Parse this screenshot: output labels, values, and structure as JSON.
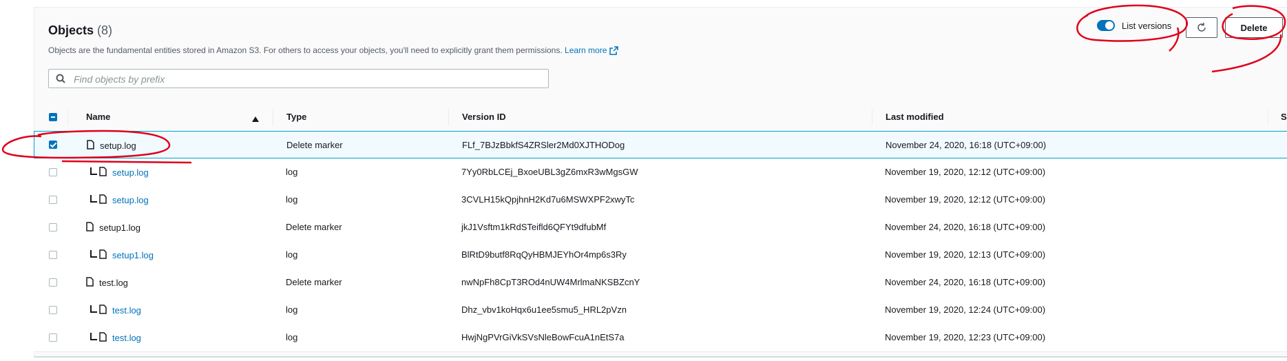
{
  "header": {
    "title": "Objects",
    "count": "(8)",
    "description": "Objects are the fundamental entities stored in Amazon S3. For others to access your objects, you'll need to explicitly grant them permissions.",
    "learn_more": "Learn more"
  },
  "toolbar": {
    "list_versions_label": "List versions",
    "list_versions_on": true,
    "delete_label": "Delete"
  },
  "search": {
    "placeholder": "Find objects by prefix",
    "value": ""
  },
  "table": {
    "columns": [
      "Name",
      "Type",
      "Version ID",
      "Last modified",
      "S"
    ],
    "rows": [
      {
        "name": "setup.log",
        "type": "Delete marker",
        "version_id": "FLf_7BJzBbkfS4ZRSler2Md0XJTHODog",
        "last_modified": "November 24, 2020, 16:18 (UTC+09:00)",
        "checked": true,
        "child": false
      },
      {
        "name": "setup.log",
        "type": "log",
        "version_id": "7Yy0RbLCEj_BxoeUBL3gZ6mxR3wMgsGW",
        "last_modified": "November 19, 2020, 12:12 (UTC+09:00)",
        "checked": false,
        "child": true
      },
      {
        "name": "setup.log",
        "type": "log",
        "version_id": "3CVLH15kQpjhnH2Kd7u6MSWXPF2xwyTc",
        "last_modified": "November 19, 2020, 12:12 (UTC+09:00)",
        "checked": false,
        "child": true
      },
      {
        "name": "setup1.log",
        "type": "Delete marker",
        "version_id": "jkJ1Vsftm1kRdSTeifld6QFYt9dfubMf",
        "last_modified": "November 24, 2020, 16:18 (UTC+09:00)",
        "checked": false,
        "child": false
      },
      {
        "name": "setup1.log",
        "type": "log",
        "version_id": "BlRtD9butf8RqQyHBMJEYhOr4mp6s3Ry",
        "last_modified": "November 19, 2020, 12:13 (UTC+09:00)",
        "checked": false,
        "child": true
      },
      {
        "name": "test.log",
        "type": "Delete marker",
        "version_id": "nwNpFh8CpT3ROd4nUW4MrlmaNKSBZcnY",
        "last_modified": "November 24, 2020, 16:18 (UTC+09:00)",
        "checked": false,
        "child": false
      },
      {
        "name": "test.log",
        "type": "log",
        "version_id": "Dhz_vbv1koHqx6u1ee5smu5_HRL2pVzn",
        "last_modified": "November 19, 2020, 12:24 (UTC+09:00)",
        "checked": false,
        "child": true
      },
      {
        "name": "test.log",
        "type": "log",
        "version_id": "HwjNgPVrGiVkSVsNleBowFcuA1nEtS7a",
        "last_modified": "November 19, 2020, 12:23 (UTC+09:00)",
        "checked": false,
        "child": true
      }
    ]
  },
  "colors": {
    "accent": "#0073bb",
    "annotation": "#e0001b"
  },
  "icons": {
    "search": "search-icon",
    "external": "external-link-icon",
    "refresh": "refresh-icon",
    "file": "file-icon",
    "sort": "sort-ascending-icon"
  }
}
